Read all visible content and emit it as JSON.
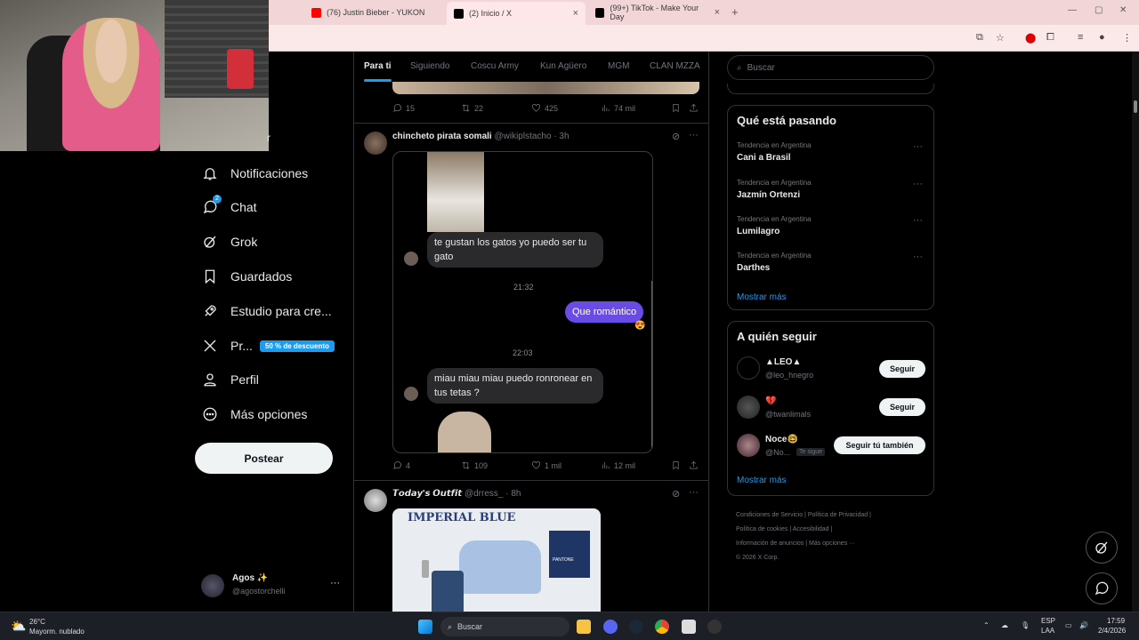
{
  "browser": {
    "tabs": [
      {
        "title": "(76) Justin Bieber - YUKON",
        "color": "#ff0000"
      },
      {
        "title": "(2) Inicio / X",
        "color": "#000000"
      },
      {
        "title": "(99+) TikTok - Make Your Day",
        "color": "#000000"
      }
    ]
  },
  "nav": {
    "partial": "r",
    "items": [
      {
        "label": "Notificaciones",
        "icon": "bell-icon"
      },
      {
        "label": "Chat",
        "icon": "chat-icon",
        "badge": "2"
      },
      {
        "label": "Grok",
        "icon": "grok-icon"
      },
      {
        "label": "Guardados",
        "icon": "bookmark-icon"
      },
      {
        "label": "Estudio para cre...",
        "icon": "rocket-icon"
      },
      {
        "label": "Pr...",
        "icon": "x-logo-icon",
        "badge": "50 % de descuento"
      },
      {
        "label": "Perfil",
        "icon": "person-icon"
      },
      {
        "label": "Más opciones",
        "icon": "more-circle-icon"
      }
    ],
    "post_label": "Postear"
  },
  "account": {
    "name": "Agos ✨",
    "handle": "@agostorchelli",
    "more": "···"
  },
  "timeline": {
    "tabs": [
      "Para ti",
      "Siguiendo",
      "Coscu Army",
      "Kun Agüero",
      "MGM",
      "CLAN MZZA"
    ],
    "top_actions": {
      "replies": "15",
      "reposts": "22",
      "likes": "425",
      "views": "74 mil"
    },
    "tweet1": {
      "name": "chincheto pirata somali",
      "handle": "@wikiplstacho",
      "time": "· 3h",
      "chat": {
        "msg1": "te gustan los gatos yo puedo ser tu gato",
        "time1": "21:32",
        "reply": "Que romántico",
        "time2": "22:03",
        "msg2": "miau miau miau puedo ronronear en tus tetas ?"
      },
      "actions": {
        "replies": "4",
        "reposts": "109",
        "likes": "1 mil",
        "views": "12 mil"
      }
    },
    "tweet2": {
      "name": "𝙏𝙤𝙙𝙖𝙮'𝙨 𝙊𝙪𝙩𝙛𝙞𝙩",
      "handle": "@drress_",
      "time": "· 8h",
      "image_title": "IMPERIAL BLUE",
      "pantone": "PANTONE"
    }
  },
  "sidebar": {
    "search_placeholder": "Buscar",
    "trends_title": "Qué está pasando",
    "trends": [
      {
        "meta": "Tendencia en Argentina",
        "name": "Cani a Brasil"
      },
      {
        "meta": "Tendencia en Argentina",
        "name": "Jazmín Ortenzi"
      },
      {
        "meta": "Tendencia en Argentina",
        "name": "Lumilagro"
      },
      {
        "meta": "Tendencia en Argentina",
        "name": "Darthes"
      }
    ],
    "trends_more": "Mostrar más",
    "follow_title": "A quién seguir",
    "follow": [
      {
        "name": "▲LEO▲",
        "handle": "@leo_hnegro",
        "button": "Seguir"
      },
      {
        "name": "💔",
        "handle": "@twanlimals",
        "button": "Seguir"
      },
      {
        "name": "Noce🤓",
        "handle": "@No...",
        "tag": "Te sigue",
        "button": "Seguir tú también"
      }
    ],
    "follow_more": "Mostrar más",
    "footer": [
      "Condiciones de Servicio",
      "Política de Privacidad",
      "Política de cookies",
      "Accesibilidad",
      "Información de anuncios",
      "Más opciones ···",
      "© 2026 X Corp."
    ]
  },
  "taskbar": {
    "weather_temp": "26°C",
    "weather_desc": "Mayorm. nublado",
    "search": "Buscar",
    "lang1": "ESP",
    "lang2": "LAA",
    "time": "17:59",
    "date": "2/4/2026"
  }
}
